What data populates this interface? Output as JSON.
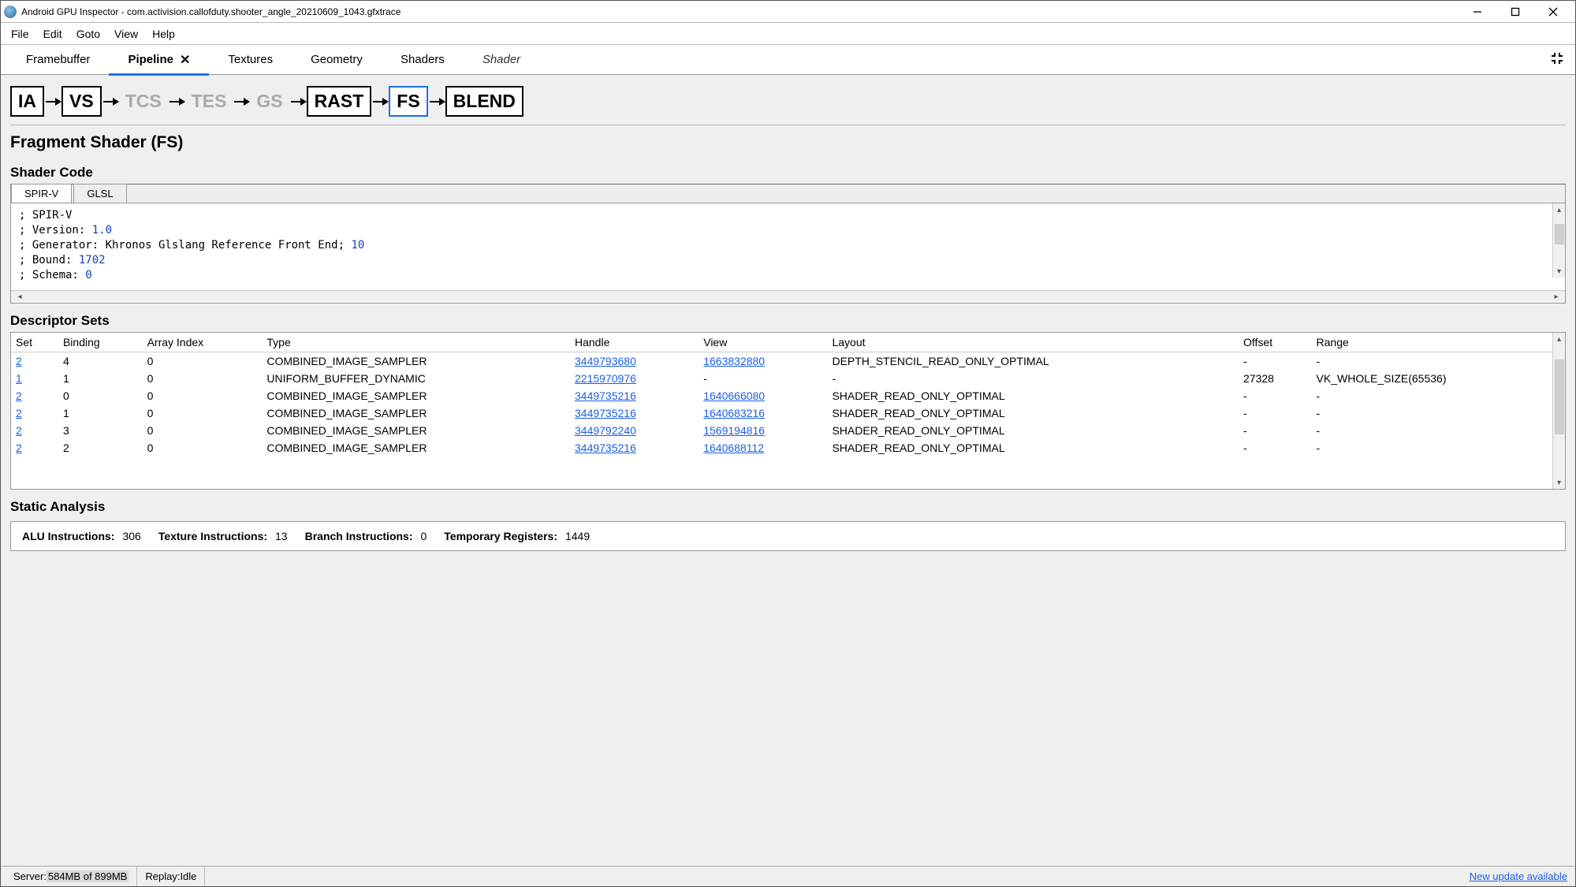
{
  "window_title": "Android GPU Inspector - com.activision.callofduty.shooter_angle_20210609_1043.gfxtrace",
  "menu": [
    "File",
    "Edit",
    "Goto",
    "View",
    "Help"
  ],
  "tabs": [
    "Framebuffer",
    "Pipeline",
    "Textures",
    "Geometry",
    "Shaders",
    "Shader"
  ],
  "active_tab": "Pipeline",
  "pipeline": {
    "stages": [
      {
        "label": "IA",
        "state": "enabled"
      },
      {
        "label": "VS",
        "state": "enabled"
      },
      {
        "label": "TCS",
        "state": "disabled"
      },
      {
        "label": "TES",
        "state": "disabled"
      },
      {
        "label": "GS",
        "state": "disabled"
      },
      {
        "label": "RAST",
        "state": "enabled"
      },
      {
        "label": "FS",
        "state": "selected"
      },
      {
        "label": "BLEND",
        "state": "enabled"
      }
    ],
    "heading": "Fragment Shader (FS)"
  },
  "shader_code": {
    "section_heading": "Shader Code",
    "tabs": [
      "SPIR-V",
      "GLSL"
    ],
    "active": "SPIR-V",
    "lines": [
      "; SPIR-V",
      "; Version: 1.0",
      "; Generator: Khronos Glslang Reference Front End; 10",
      "; Bound: 1702",
      "; Schema: 0"
    ],
    "numbers": [
      "1.0",
      "10",
      "1702",
      "0"
    ]
  },
  "descriptor_sets": {
    "section_heading": "Descriptor Sets",
    "columns": [
      "Set",
      "Binding",
      "Array Index",
      "Type",
      "Handle",
      "View",
      "Layout",
      "Offset",
      "Range"
    ],
    "rows": [
      {
        "set": "2",
        "binding": "4",
        "array": "0",
        "type": "COMBINED_IMAGE_SAMPLER",
        "handle": "3449793680",
        "view": "1663832880",
        "layout": "DEPTH_STENCIL_READ_ONLY_OPTIMAL",
        "offset": "-",
        "range": "-"
      },
      {
        "set": "1",
        "binding": "1",
        "array": "0",
        "type": "UNIFORM_BUFFER_DYNAMIC",
        "handle": "2215970976",
        "view": "-",
        "layout": "-",
        "offset": "27328",
        "range": "VK_WHOLE_SIZE(65536)"
      },
      {
        "set": "2",
        "binding": "0",
        "array": "0",
        "type": "COMBINED_IMAGE_SAMPLER",
        "handle": "3449735216",
        "view": "1640666080",
        "layout": "SHADER_READ_ONLY_OPTIMAL",
        "offset": "-",
        "range": "-"
      },
      {
        "set": "2",
        "binding": "1",
        "array": "0",
        "type": "COMBINED_IMAGE_SAMPLER",
        "handle": "3449735216",
        "view": "1640683216",
        "layout": "SHADER_READ_ONLY_OPTIMAL",
        "offset": "-",
        "range": "-"
      },
      {
        "set": "2",
        "binding": "3",
        "array": "0",
        "type": "COMBINED_IMAGE_SAMPLER",
        "handle": "3449792240",
        "view": "1569194816",
        "layout": "SHADER_READ_ONLY_OPTIMAL",
        "offset": "-",
        "range": "-"
      },
      {
        "set": "2",
        "binding": "2",
        "array": "0",
        "type": "COMBINED_IMAGE_SAMPLER",
        "handle": "3449735216",
        "view": "1640688112",
        "layout": "SHADER_READ_ONLY_OPTIMAL",
        "offset": "-",
        "range": "-"
      }
    ]
  },
  "static_analysis": {
    "section_heading": "Static Analysis",
    "metrics": [
      {
        "label": "ALU Instructions:",
        "value": "306"
      },
      {
        "label": "Texture Instructions:",
        "value": "13"
      },
      {
        "label": "Branch Instructions:",
        "value": "0"
      },
      {
        "label": "Temporary Registers:",
        "value": "1449"
      }
    ]
  },
  "status": {
    "server_label": "Server: ",
    "server_value": "584MB of 899MB",
    "replay_label": "Replay: ",
    "replay_value": "Idle",
    "update_link": "New update available"
  }
}
